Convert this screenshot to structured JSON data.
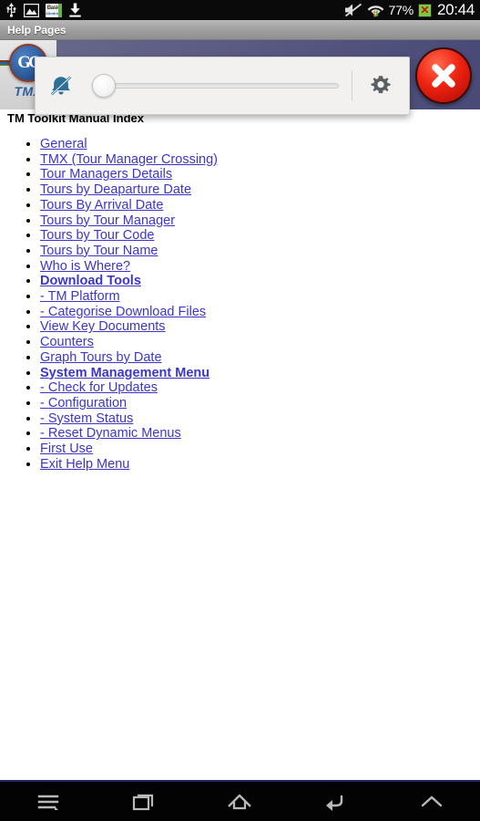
{
  "statusbar": {
    "icons": [
      "usb-icon",
      "gallery-icon",
      "basic4android-icon",
      "download-icon"
    ],
    "b4a_line1": "Basic",
    "b4a_line2": "4Android",
    "mute_icon": "volume-mute-icon",
    "wifi_icon": "wifi-icon",
    "battery_percent": "77%",
    "battery_icon": "battery-error-icon",
    "battery_badge": "✕",
    "time": "20:44"
  },
  "titlebar": {
    "title": "Help Pages"
  },
  "banner": {
    "logo_monogram": "GG",
    "logo_label": "TMX",
    "close_label": "close-button"
  },
  "volume_panel": {
    "mute_icon": "ringer-muted-icon",
    "settings_icon": "gear-icon",
    "slider_value": "0",
    "slider_min": "0",
    "slider_max": "100"
  },
  "content": {
    "heading": "TM Toolkit Manual Index",
    "links": [
      {
        "label": "General",
        "bold": false
      },
      {
        "label": "TMX (Tour Manager Crossing)",
        "bold": false
      },
      {
        "label": "Tour Managers Details",
        "bold": false
      },
      {
        "label": "Tours by Deaparture Date",
        "bold": false
      },
      {
        "label": "Tours By Arrival Date",
        "bold": false
      },
      {
        "label": "Tours by Tour Manager",
        "bold": false
      },
      {
        "label": "Tours by Tour Code",
        "bold": false
      },
      {
        "label": "Tours by Tour Name",
        "bold": false
      },
      {
        "label": "Who is Where?",
        "bold": false
      },
      {
        "label": "Download Tools",
        "bold": true
      },
      {
        "label": "- TM Platform",
        "bold": false
      },
      {
        "label": "- Categorise Download Files",
        "bold": false
      },
      {
        "label": "View Key Documents",
        "bold": false
      },
      {
        "label": "Counters",
        "bold": false
      },
      {
        "label": "Graph Tours by Date",
        "bold": false
      },
      {
        "label": "System Management Menu",
        "bold": true
      },
      {
        "label": "- Check for Updates",
        "bold": false
      },
      {
        "label": "- Configuration",
        "bold": false
      },
      {
        "label": "- System Status",
        "bold": false
      },
      {
        "label": "- Reset Dynamic Menus",
        "bold": false
      },
      {
        "label": "First Use",
        "bold": false
      },
      {
        "label": "Exit Help Menu",
        "bold": false
      }
    ]
  },
  "navbar": {
    "buttons": [
      "menu-icon",
      "recent-apps-icon",
      "home-icon",
      "back-icon",
      "chevron-up-icon"
    ]
  },
  "colors": {
    "link": "#3c36c8",
    "banner": "#53537e",
    "close_red": "#ee2211",
    "mute_blue": "#2e6f96",
    "battery_green": "#7ac943"
  }
}
